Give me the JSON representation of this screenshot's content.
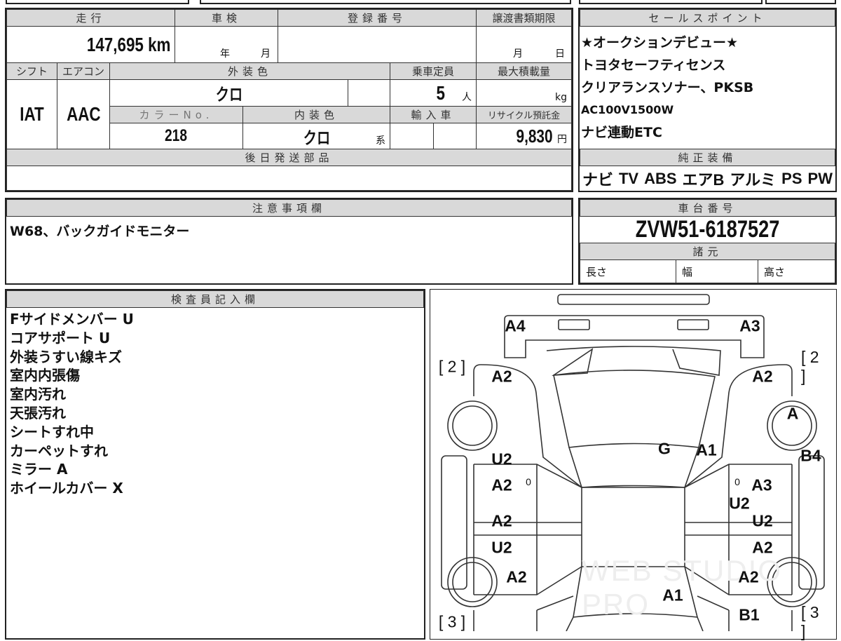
{
  "vehicle": {
    "mileage_label": "走行",
    "mileage": "147,695 km",
    "shaken_label": "車検",
    "year_unit": "年",
    "month_unit": "月",
    "reg_label": "登録番号",
    "transfer_label": "譲渡書類期限",
    "day_unit": "日",
    "shift_label": "シフト",
    "shift": "IAT",
    "ac_label": "エアコン",
    "ac": "AAC",
    "ext_color_label": "外装色",
    "ext_color": "クロ",
    "capacity_label": "乗車定員",
    "capacity": "5",
    "capacity_unit": "人",
    "load_label": "最大積載量",
    "load_unit": "kg",
    "color_no_label": "カラーNo.",
    "color_no": "218",
    "int_color_label": "内装色",
    "int_color": "クロ",
    "int_suffix": "系",
    "import_label": "輸入車",
    "recycle_label": "リサイクル預託金",
    "recycle": "9,830",
    "yen": "円",
    "later_parts_label": "後日発送部品"
  },
  "notes": {
    "label": "注意事項欄",
    "text": "W68、バックガイドモニター"
  },
  "sale_points": {
    "label": "セールスポイント",
    "lines": [
      "★オークションデビュー★",
      "トヨタセーフティセンス",
      "クリアランスソナー、PKSB",
      "AC100V1500W",
      "ナビ連動ETC"
    ]
  },
  "equipment": {
    "label": "純正装備",
    "items": [
      "ナビ",
      "TV",
      "ABS",
      "エアB",
      "アルミ",
      "PS",
      "PW"
    ]
  },
  "chassis": {
    "label": "車台番号",
    "number": "ZVW51-6187527"
  },
  "specs": {
    "label": "諸元",
    "length": "長さ",
    "width": "幅",
    "height": "高さ"
  },
  "inspector": {
    "label": "検査員記入欄",
    "lines": [
      "Fサイドメンバー U",
      "コアサポート U",
      "外装うすい線キズ",
      "室内内張傷",
      "室内汚れ",
      "天張汚れ",
      "シートすれ中",
      "カーペットすれ",
      "ミラー A",
      "ホイールカバー X"
    ]
  },
  "diagram": {
    "marks": [
      "A4",
      "A3",
      "[ 2 ]",
      "[ 2 ]",
      "A2",
      "A2",
      "A",
      "G",
      "A1",
      "B4",
      "U2",
      "A2",
      "0",
      "0",
      "A3",
      "U2",
      "A2",
      "U2",
      "U2",
      "A2",
      "A2",
      "A2",
      "A1",
      "B1",
      "[ 3 ]",
      "[ 3 ]"
    ],
    "watermark": "WEB STUDIO PRO"
  }
}
